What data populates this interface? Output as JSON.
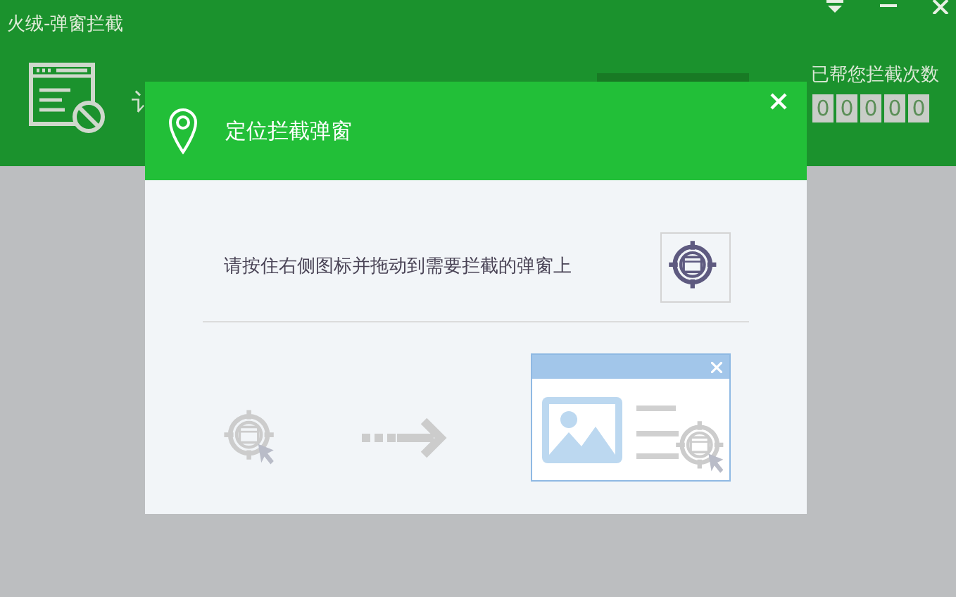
{
  "window": {
    "title": "火绒-弹窗拦截"
  },
  "header": {
    "partial_text": "讠",
    "counter_label": "已帮您拦截次数",
    "counter_digits": [
      "0",
      "0",
      "0",
      "0",
      "0"
    ]
  },
  "dialog": {
    "title": "定位拦截弹窗",
    "instruction": "请按住右侧图标并拖动到需要拦截的弹窗上"
  }
}
